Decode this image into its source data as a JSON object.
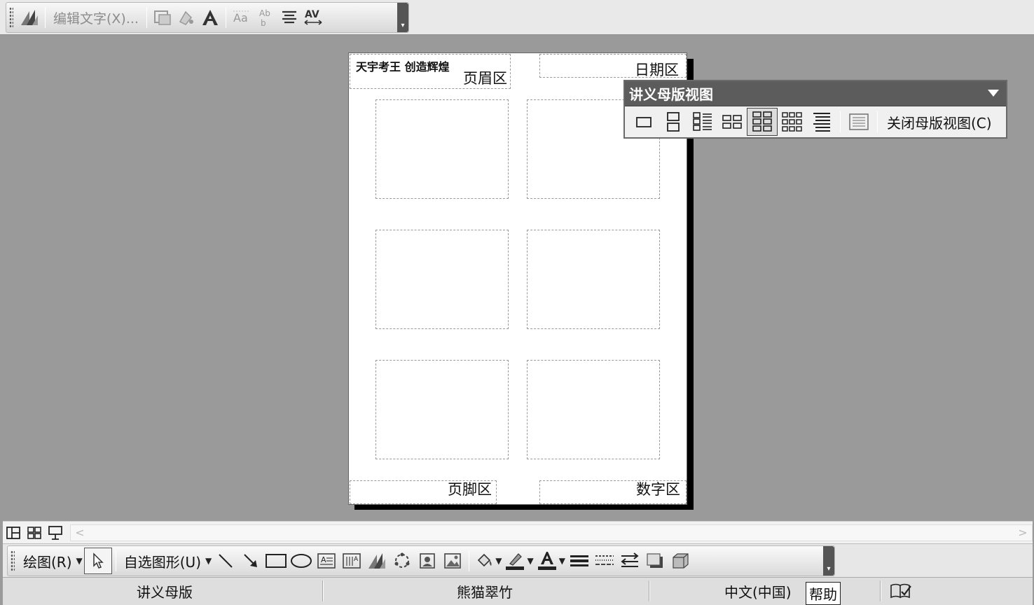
{
  "wordart_toolbar": {
    "edit_text_label": "编辑文字(X)..."
  },
  "handout": {
    "header_text": "天宇考王 创造辉煌",
    "header_zone_label": "页眉区",
    "date_zone_label": "日期区",
    "footer_zone_label": "页脚区",
    "number_zone_label": "数字区"
  },
  "master_toolbar": {
    "title": "讲义母版视图",
    "close_label": "关闭母版视图(C)"
  },
  "drawing_toolbar": {
    "draw_label": "绘图(R)",
    "autoshape_label": "自选图形(U)"
  },
  "status_bar": {
    "view_name": "讲义母版",
    "design_name": "熊猫翠竹",
    "language": "中文(中国)",
    "help_tooltip": "帮助"
  }
}
